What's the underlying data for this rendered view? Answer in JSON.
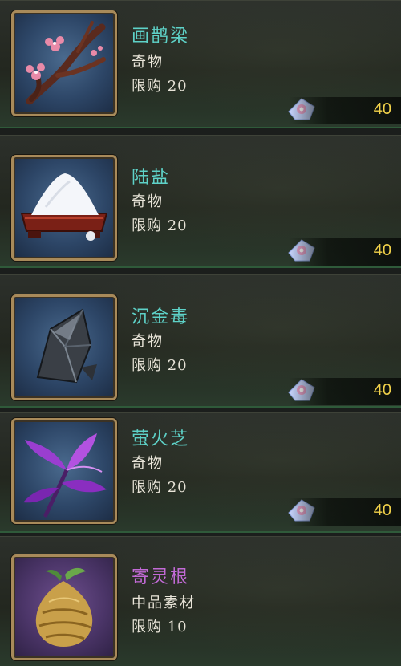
{
  "items": [
    {
      "name": "画鹊梁",
      "type": "奇物",
      "limit_label": "限购",
      "limit": "20",
      "price": "40",
      "icon": "plum-blossom-branch-icon",
      "quality": "blue"
    },
    {
      "name": "陆盐",
      "type": "奇物",
      "limit_label": "限购",
      "limit": "20",
      "price": "40",
      "icon": "salt-tray-icon",
      "quality": "blue"
    },
    {
      "name": "沉金毒",
      "type": "奇物",
      "limit_label": "限购",
      "limit": "20",
      "price": "40",
      "icon": "dark-crystal-icon",
      "quality": "blue"
    },
    {
      "name": "萤火芝",
      "type": "奇物",
      "limit_label": "限购",
      "limit": "20",
      "price": "40",
      "icon": "purple-herb-icon",
      "quality": "blue"
    },
    {
      "name": "寄灵根",
      "type": "中品素材",
      "limit_label": "限购",
      "limit": "10",
      "price": "",
      "icon": "golden-root-icon",
      "quality": "purple"
    }
  ],
  "currency_icon": "jade-flower-currency-icon",
  "colors": {
    "name_common": "#5ed2c8",
    "name_epic": "#c26ad6",
    "price": "#f2d24a",
    "frame_border": "#a88a5a"
  }
}
